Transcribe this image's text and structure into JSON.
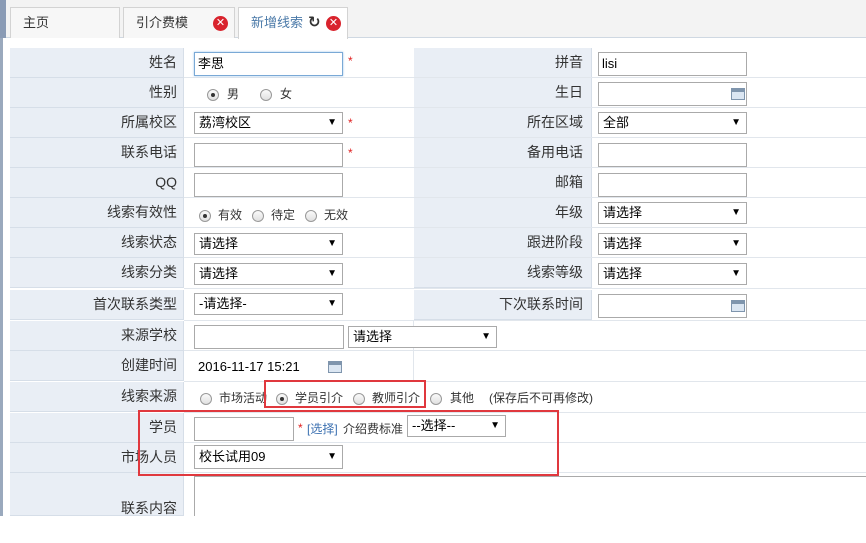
{
  "tabs": [
    {
      "label": "主页"
    },
    {
      "label": "引介费模"
    },
    {
      "label": "新增线索"
    }
  ],
  "icons": {
    "close": "✕",
    "refresh": "↻"
  },
  "form": {
    "name_label": "姓名",
    "name_value": "李思",
    "pinyin_label": "拼音",
    "pinyin_value": "lisi",
    "gender_label": "性别",
    "gender_male": "男",
    "gender_female": "女",
    "gender_selected": "男",
    "birthday_label": "生日",
    "campus_label": "所属校区",
    "campus_value": "荔湾校区",
    "region_label": "所在区域",
    "region_value": "全部",
    "phone_label": "联系电话",
    "alt_phone_label": "备用电话",
    "qq_label": "QQ",
    "email_label": "邮箱",
    "validity_label": "线索有效性",
    "validity_valid": "有效",
    "validity_pending": "待定",
    "validity_invalid": "无效",
    "validity_selected": "有效",
    "grade_label": "年级",
    "grade_value": "请选择",
    "status_label": "线索状态",
    "status_value": "请选择",
    "follow_stage_label": "跟进阶段",
    "follow_stage_value": "请选择",
    "category_label": "线索分类",
    "category_value": "请选择",
    "level_label": "线索等级",
    "level_value": "请选择",
    "first_contact_label": "首次联系类型",
    "first_contact_value": "-请选择-",
    "next_contact_label": "下次联系时间",
    "source_school_label": "来源学校",
    "source_school_select": "请选择",
    "created_label": "创建时间",
    "created_value": "2016-11-17 15:21",
    "source_label": "线索来源",
    "source_market": "市场活动",
    "source_student": "学员引介",
    "source_teacher": "教师引介",
    "source_other": "其他",
    "source_selected": "学员引介",
    "source_note": "(保存后不可再修改)",
    "student_label": "学员",
    "student_select_link": "[选择]",
    "fee_standard_label": "介绍费标准",
    "fee_standard_value": "--选择--",
    "marketer_label": "市场人员",
    "marketer_value": "校长试用09",
    "content_label": "联系内容"
  }
}
